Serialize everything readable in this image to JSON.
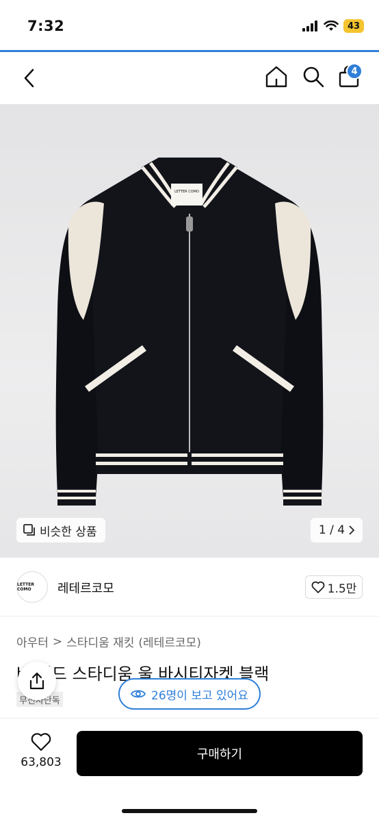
{
  "status_bar": {
    "time": "7:32",
    "battery": "43"
  },
  "nav": {
    "cart_badge": "4"
  },
  "gallery": {
    "similar_label": "비슷한 상품",
    "pager": "1 / 4",
    "jacket_tag_text": "LETTER COMO"
  },
  "shop": {
    "logo_text": "LETTER COMO",
    "name": "레테르코모",
    "likes": "1.5만"
  },
  "product": {
    "breadcrumb": [
      "아우터",
      "스타디움 재킷",
      "(레테르코모)"
    ],
    "breadcrumb_separator": ">",
    "title": "버     워드 스타디움 울 바시티자켓 블랙",
    "badge": "무신사단독"
  },
  "viewers": {
    "text": "26명이 보고 있어요"
  },
  "bottom": {
    "wish_count": "63,803",
    "buy_label": "구매하기"
  },
  "colors": {
    "accent": "#2f7fd9",
    "buy_button": "#000000",
    "battery": "#f4c430"
  }
}
